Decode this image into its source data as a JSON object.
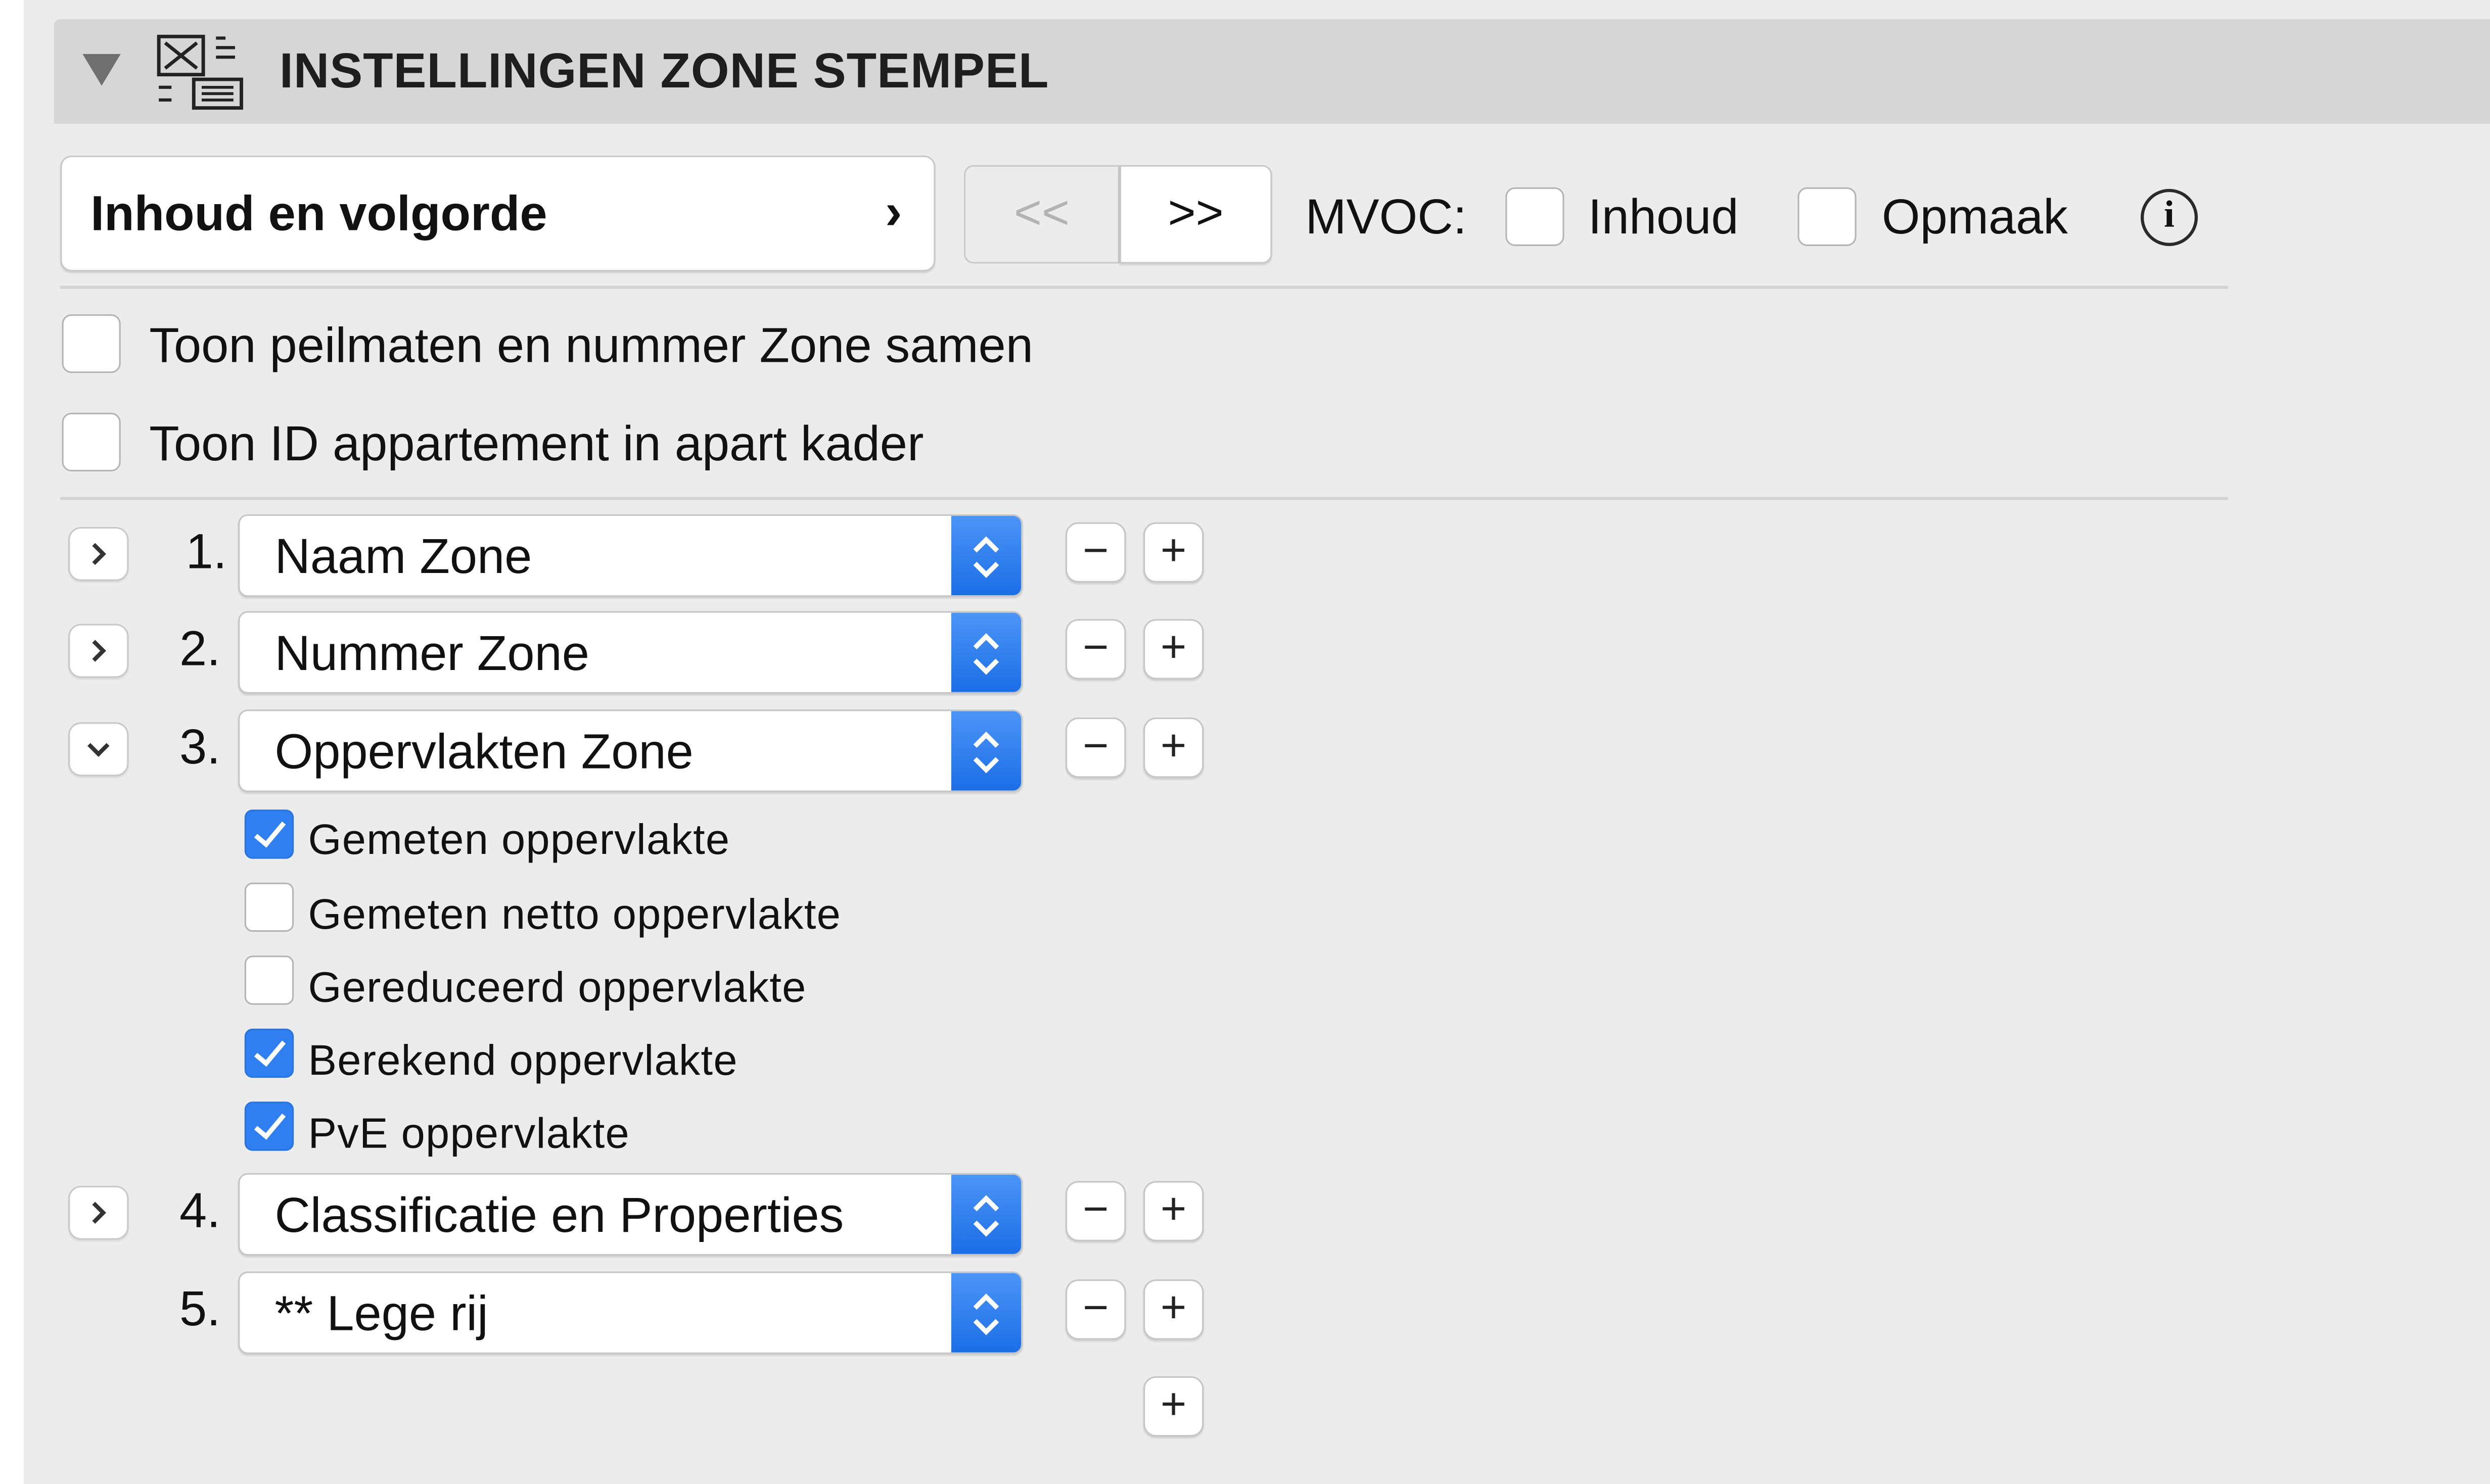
{
  "header": {
    "title": "INSTELLINGEN ZONE STEMPEL",
    "icon": "zone-stamp-icon"
  },
  "toolbar": {
    "content_button_label": "Inhoud en volgorde",
    "content_button_chevron": "›",
    "prev_label": "<<",
    "next_label": ">>",
    "mvoc_label": "MVOC:",
    "mvoc_inhoud_label": "Inhoud",
    "mvoc_inhoud_checked": false,
    "mvoc_opmaak_label": "Opmaak",
    "mvoc_opmaak_checked": false,
    "info_glyph": "i"
  },
  "options": [
    {
      "label": "Toon peilmaten en nummer Zone samen",
      "checked": false
    },
    {
      "label": "Toon ID appartement in apart kader",
      "checked": false
    }
  ],
  "rows": [
    {
      "number": "1.",
      "value": "Naam Zone",
      "expanded": false
    },
    {
      "number": "2.",
      "value": "Nummer Zone",
      "expanded": false
    },
    {
      "number": "3.",
      "value": "Oppervlakten Zone",
      "expanded": true,
      "sub_options": [
        {
          "label": "Gemeten oppervlakte",
          "checked": true
        },
        {
          "label": "Gemeten netto oppervlakte",
          "checked": false
        },
        {
          "label": "Gereduceerd oppervlakte",
          "checked": false
        },
        {
          "label": "Berekend oppervlakte",
          "checked": true
        },
        {
          "label": "PvE oppervlakte",
          "checked": true
        }
      ]
    },
    {
      "number": "4.",
      "value": "Classificatie en Properties",
      "expanded": false
    },
    {
      "number": "5.",
      "value": "** Lege rij",
      "expanded": false
    }
  ],
  "row_controls": {
    "minus": "−",
    "plus": "+"
  },
  "colors": {
    "accent": "#2f7ff0",
    "header_bg": "#d6d6d6",
    "panel_bg": "#ececec"
  }
}
